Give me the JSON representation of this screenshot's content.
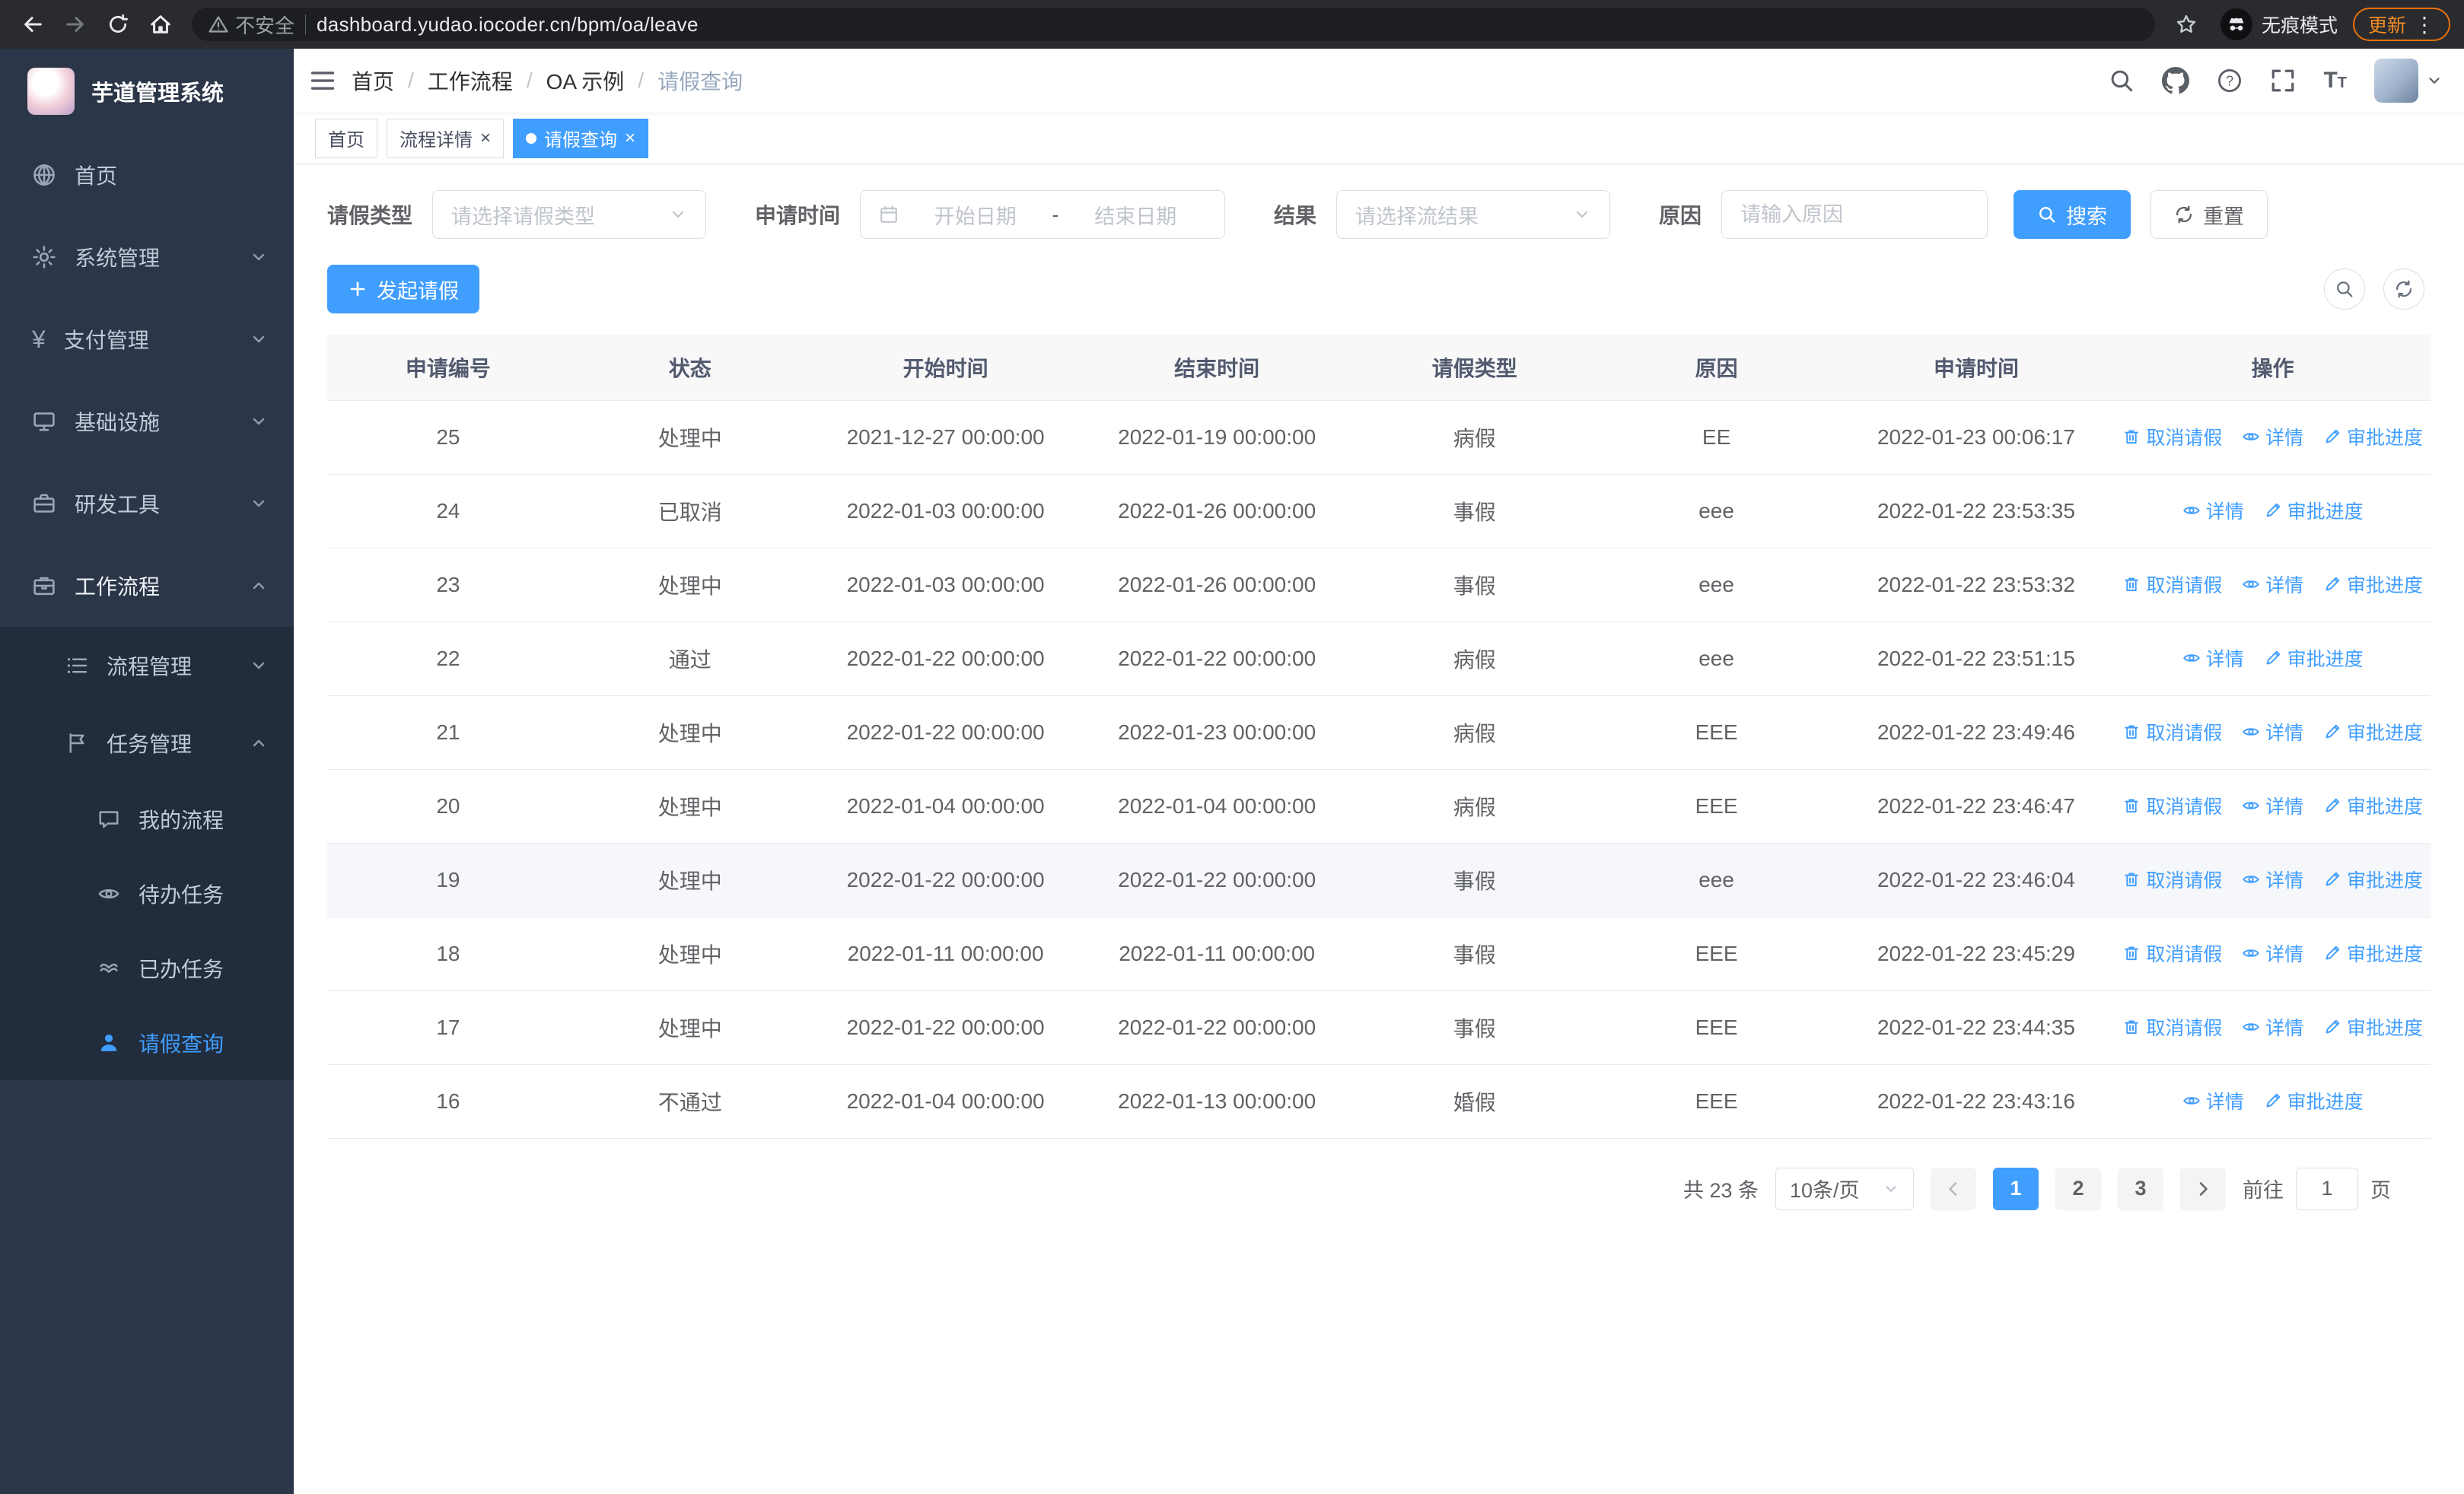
{
  "colors": {
    "accent": "#409eff",
    "sidebar_bg": "#2b3648",
    "submenu_bg": "#212c3c",
    "table_header_bg": "#f8f8f9",
    "update_orange": "#e8710a"
  },
  "browser": {
    "security_warning": "不安全",
    "url": "dashboard.yudao.iocoder.cn/bpm/oa/leave",
    "incognito_label": "无痕模式",
    "update_label": "更新",
    "menu_dots": "⋮"
  },
  "sidebar": {
    "logo_title": "芋道管理系统",
    "items": [
      {
        "label": "首页"
      },
      {
        "label": "系统管理"
      },
      {
        "label": "支付管理"
      },
      {
        "label": "基础设施"
      },
      {
        "label": "研发工具"
      },
      {
        "label": "工作流程"
      }
    ],
    "submenu": [
      {
        "label": "流程管理"
      },
      {
        "label": "任务管理"
      }
    ],
    "task_items": [
      {
        "label": "我的流程"
      },
      {
        "label": "待办任务"
      },
      {
        "label": "已办任务"
      },
      {
        "label": "请假查询"
      }
    ]
  },
  "header": {
    "breadcrumb": [
      "首页",
      "工作流程",
      "OA 示例",
      "请假查询"
    ],
    "separator": "/"
  },
  "tabs": [
    {
      "label": "首页"
    },
    {
      "label": "流程详情"
    },
    {
      "label": "请假查询"
    }
  ],
  "filters": {
    "leave_type_label": "请假类型",
    "leave_type_placeholder": "请选择请假类型",
    "apply_time_label": "申请时间",
    "start_date_placeholder": "开始日期",
    "range_separator": "-",
    "end_date_placeholder": "结束日期",
    "result_label": "结果",
    "result_placeholder": "请选择流结果",
    "reason_label": "原因",
    "reason_placeholder": "请输入原因",
    "search_button": "搜索",
    "reset_button": "重置"
  },
  "toolbar": {
    "create_button": "发起请假"
  },
  "table": {
    "columns": [
      "申请编号",
      "状态",
      "开始时间",
      "结束时间",
      "请假类型",
      "原因",
      "申请时间",
      "操作"
    ],
    "actions": {
      "cancel": "取消请假",
      "detail": "详情",
      "progress": "审批进度"
    },
    "rows": [
      {
        "id": "25",
        "status": "处理中",
        "start": "2021-12-27 00:00:00",
        "end": "2022-01-19 00:00:00",
        "type": "病假",
        "reason": "EE",
        "apply_time": "2022-01-23 00:06:17",
        "can_cancel": true
      },
      {
        "id": "24",
        "status": "已取消",
        "start": "2022-01-03 00:00:00",
        "end": "2022-01-26 00:00:00",
        "type": "事假",
        "reason": "eee",
        "apply_time": "2022-01-22 23:53:35",
        "can_cancel": false
      },
      {
        "id": "23",
        "status": "处理中",
        "start": "2022-01-03 00:00:00",
        "end": "2022-01-26 00:00:00",
        "type": "事假",
        "reason": "eee",
        "apply_time": "2022-01-22 23:53:32",
        "can_cancel": true
      },
      {
        "id": "22",
        "status": "通过",
        "start": "2022-01-22 00:00:00",
        "end": "2022-01-22 00:00:00",
        "type": "病假",
        "reason": "eee",
        "apply_time": "2022-01-22 23:51:15",
        "can_cancel": false
      },
      {
        "id": "21",
        "status": "处理中",
        "start": "2022-01-22 00:00:00",
        "end": "2022-01-23 00:00:00",
        "type": "病假",
        "reason": "EEE",
        "apply_time": "2022-01-22 23:49:46",
        "can_cancel": true
      },
      {
        "id": "20",
        "status": "处理中",
        "start": "2022-01-04 00:00:00",
        "end": "2022-01-04 00:00:00",
        "type": "病假",
        "reason": "EEE",
        "apply_time": "2022-01-22 23:46:47",
        "can_cancel": true
      },
      {
        "id": "19",
        "status": "处理中",
        "start": "2022-01-22 00:00:00",
        "end": "2022-01-22 00:00:00",
        "type": "事假",
        "reason": "eee",
        "apply_time": "2022-01-22 23:46:04",
        "can_cancel": true,
        "hover": true
      },
      {
        "id": "18",
        "status": "处理中",
        "start": "2022-01-11 00:00:00",
        "end": "2022-01-11 00:00:00",
        "type": "事假",
        "reason": "EEE",
        "apply_time": "2022-01-22 23:45:29",
        "can_cancel": true
      },
      {
        "id": "17",
        "status": "处理中",
        "start": "2022-01-22 00:00:00",
        "end": "2022-01-22 00:00:00",
        "type": "事假",
        "reason": "EEE",
        "apply_time": "2022-01-22 23:44:35",
        "can_cancel": true
      },
      {
        "id": "16",
        "status": "不通过",
        "start": "2022-01-04 00:00:00",
        "end": "2022-01-13 00:00:00",
        "type": "婚假",
        "reason": "EEE",
        "apply_time": "2022-01-22 23:43:16",
        "can_cancel": false
      }
    ]
  },
  "pagination": {
    "total_text": "共 23 条",
    "page_size": "10条/页",
    "pages": [
      "1",
      "2",
      "3"
    ],
    "active_page": "1",
    "goto_label": "前往",
    "goto_value": "1",
    "goto_suffix": "页"
  }
}
